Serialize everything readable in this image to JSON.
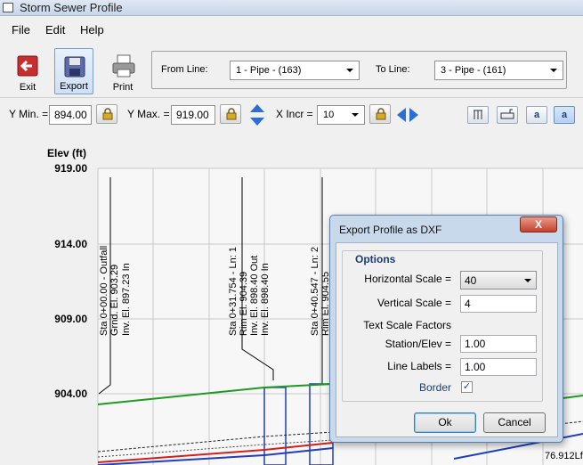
{
  "window": {
    "title": "Storm Sewer Profile"
  },
  "menu": [
    "File",
    "Edit",
    "Help"
  ],
  "toolbar": {
    "exit_label": "Exit",
    "export_label": "Export",
    "print_label": "Print",
    "from_line_label": "From Line:",
    "from_line_value": "1 - Pipe - (163)",
    "to_line_label": "To Line:",
    "to_line_value": "3 - Pipe - (161)"
  },
  "scale": {
    "ymin_label": "Y Min. =",
    "ymin_value": "894.00",
    "ymax_label": "Y Max. =",
    "ymax_value": "919.00",
    "xincr_label": "X Incr =",
    "xincr_value": "10",
    "btn_a1": "a",
    "btn_a2": "a"
  },
  "chart": {
    "ylabel": "Elev (ft)",
    "yticks": [
      "919.00",
      "914.00",
      "909.00",
      "904.00"
    ],
    "annotations": [
      [
        "Sta 0+00.00 - Outfall",
        "Grnd. El. 903.29",
        "Inv. El. 897.23 In"
      ],
      [
        "Sta 0+31.754 - Ln: 1",
        "Rim El. 904.39",
        "Inv. El. 898.40 Out",
        "Inv. El. 898.40 In"
      ],
      [
        "Sta 0+40.547 - Ln: 2",
        "Rim El. 904.55"
      ]
    ],
    "corner_text": "76.912Lf -",
    "colors": {
      "ground": "#1f9a1f",
      "hgl": "#d21e1e",
      "pipe": "#1f3fb8"
    }
  },
  "dialog": {
    "title": "Export Profile as DXF",
    "close": "X",
    "options_title": "Options",
    "horizontal_scale_label": "Horizontal Scale =",
    "horizontal_scale_value": "40",
    "vertical_scale_label": "Vertical Scale =",
    "vertical_scale_value": "4",
    "text_scale_title": "Text Scale Factors",
    "station_label": "Station/Elev =",
    "station_value": "1.00",
    "line_labels_label": "Line Labels =",
    "line_labels_value": "1.00",
    "border_label": "Border",
    "border_checked": "✓",
    "ok_label": "Ok",
    "cancel_label": "Cancel"
  }
}
